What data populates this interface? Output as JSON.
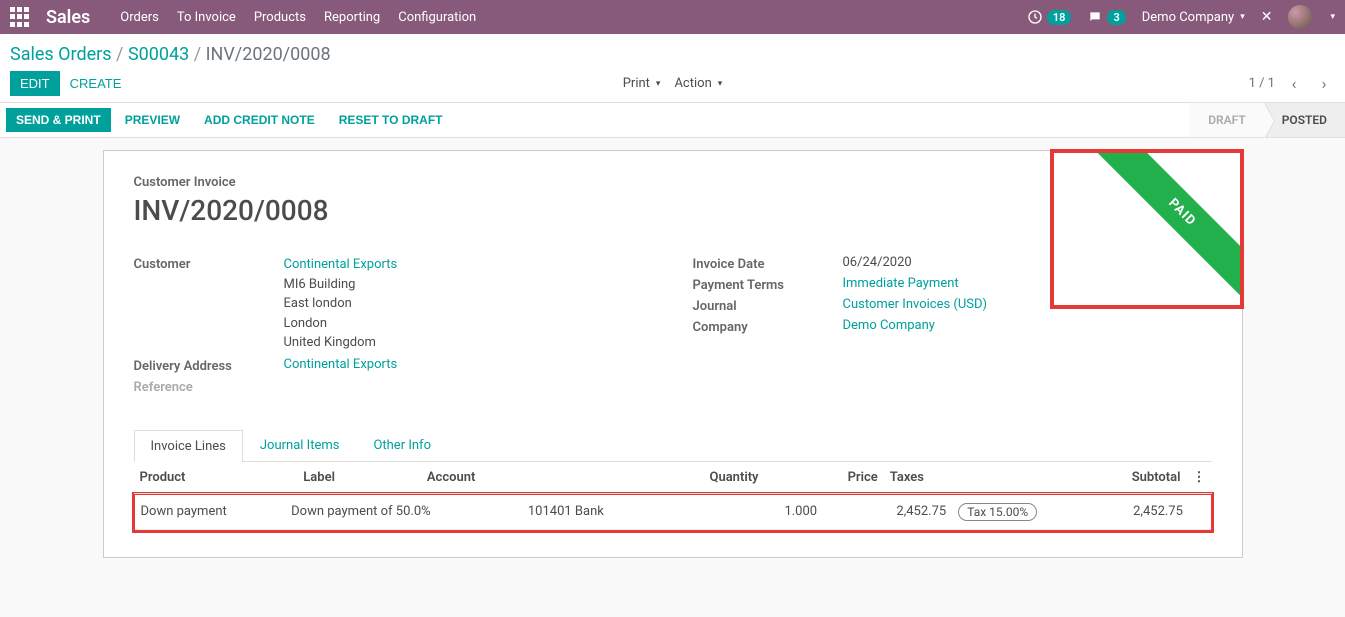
{
  "topbar": {
    "brand": "Sales",
    "menu": [
      "Orders",
      "To Invoice",
      "Products",
      "Reporting",
      "Configuration"
    ],
    "activity_count": "18",
    "message_count": "3",
    "company": "Demo Company"
  },
  "breadcrumb": {
    "root": "Sales Orders",
    "order": "S00043",
    "current": "INV/2020/0008"
  },
  "toolbar": {
    "edit": "EDIT",
    "create": "CREATE",
    "print": "Print",
    "action": "Action",
    "pager": "1 / 1"
  },
  "statusbar": {
    "send_print": "SEND & PRINT",
    "preview": "PREVIEW",
    "credit_note": "ADD CREDIT NOTE",
    "reset": "RESET TO DRAFT",
    "draft": "DRAFT",
    "posted": "POSTED"
  },
  "sheet": {
    "ribbon": "PAID",
    "subtitle": "Customer Invoice",
    "title": "INV/2020/0008",
    "labels": {
      "customer": "Customer",
      "delivery": "Delivery Address",
      "reference": "Reference",
      "invoice_date": "Invoice Date",
      "payment_terms": "Payment Terms",
      "journal": "Journal",
      "company": "Company"
    },
    "customer": {
      "name": "Continental Exports",
      "line1": "MI6 Building",
      "line2": "East london",
      "line3": "London",
      "line4": "United Kingdom"
    },
    "delivery_address": "Continental Exports",
    "invoice_date": "06/24/2020",
    "payment_terms": "Immediate Payment",
    "journal": "Customer Invoices (USD)",
    "company": "Demo Company"
  },
  "tabs": {
    "lines": "Invoice Lines",
    "journal": "Journal Items",
    "other": "Other Info"
  },
  "table": {
    "headers": {
      "product": "Product",
      "label": "Label",
      "account": "Account",
      "quantity": "Quantity",
      "price": "Price",
      "taxes": "Taxes",
      "subtotal": "Subtotal"
    },
    "row": {
      "product": "Down payment",
      "label": "Down payment of 50.0%",
      "account": "101401 Bank",
      "quantity": "1.000",
      "price": "2,452.75",
      "tax": "Tax 15.00%",
      "subtotal": "2,452.75"
    }
  }
}
